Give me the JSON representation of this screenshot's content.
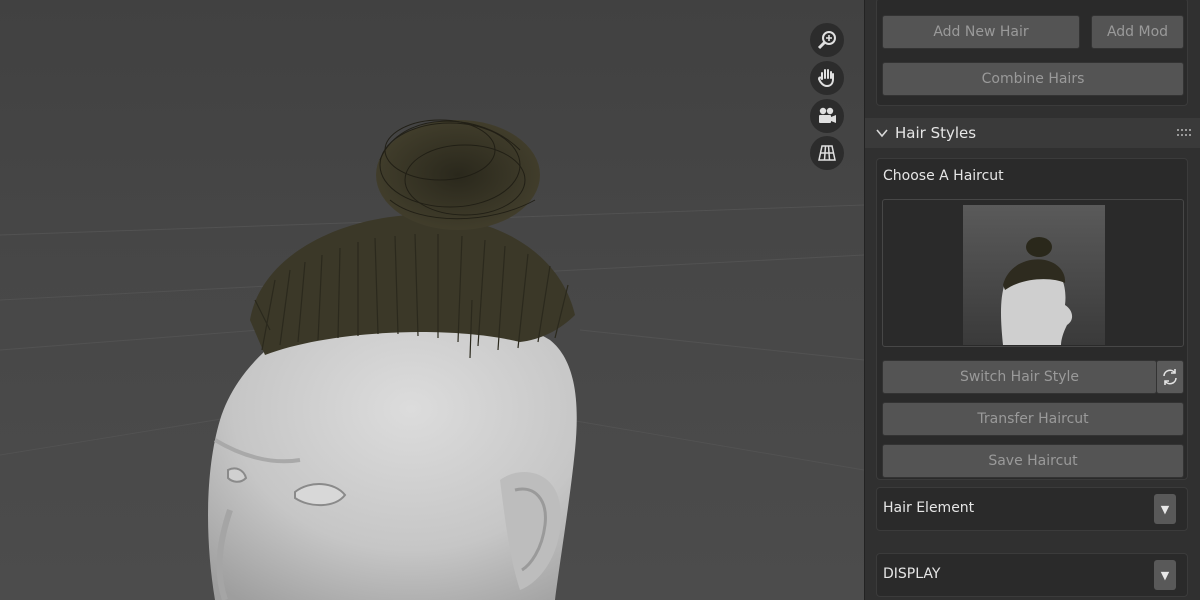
{
  "viewport": {
    "nav_icons": [
      "zoom-icon",
      "hand-pan-icon",
      "camera-icon",
      "ortho-grid-icon"
    ]
  },
  "panel": {
    "top_buttons": {
      "add_new_hair": "Add New Hair",
      "add_mod": "Add Mod",
      "combine_hairs": "Combine Hairs"
    },
    "hair_styles": {
      "section_title": "Hair Styles",
      "choose_label": "Choose A Haircut",
      "switch_style": "Switch Hair Style",
      "transfer_haircut": "Transfer Haircut",
      "save_haircut": "Save Haircut"
    },
    "hair_element": {
      "label": "Hair Element",
      "arrow": "▼"
    },
    "display": {
      "label": "DISPLAY",
      "arrow": "▼"
    }
  },
  "colors": {
    "viewport_bg": "#444444",
    "panel_bg": "#303030",
    "button_bg": "#545454",
    "hair": "#3d3a2a",
    "skin": "#c9c9c9"
  }
}
